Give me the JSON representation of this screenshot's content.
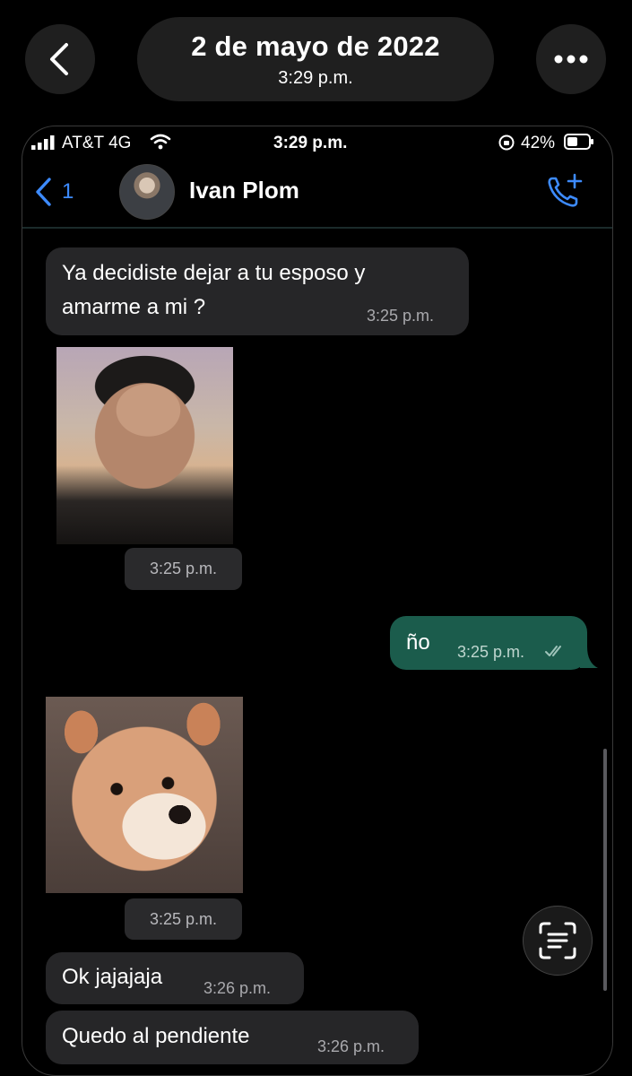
{
  "viewer": {
    "date": "2 de mayo de 2022",
    "time": "3:29 p.m."
  },
  "status_bar": {
    "carrier": "AT&T 4G",
    "time": "3:29 p.m.",
    "battery": "42%"
  },
  "chat_header": {
    "back_count": "1",
    "contact_name": "Ivan Plom"
  },
  "messages": [
    {
      "type": "text",
      "direction": "in",
      "text": "Ya decidiste dejar a tu esposo y",
      "text2": "amarme a mi ?",
      "time": "3:25 p.m."
    },
    {
      "type": "image",
      "direction": "in",
      "time": "3:25 p.m."
    },
    {
      "type": "text",
      "direction": "out",
      "text": "ño",
      "time": "3:25 p.m."
    },
    {
      "type": "image",
      "direction": "in",
      "time": "3:25 p.m."
    },
    {
      "type": "text",
      "direction": "in",
      "text": "Ok jajajaja",
      "time": "3:26 p.m."
    },
    {
      "type": "text",
      "direction": "in",
      "text": "Quedo al pendiente",
      "time": "3:26 p.m."
    }
  ],
  "colors": {
    "incoming_bubble": "#262628",
    "outgoing_bubble": "#1b5c4c",
    "accent_blue": "#3d8bff"
  },
  "icons": [
    "back-chevron-icon",
    "more-dots-icon",
    "signal-icon",
    "wifi-icon",
    "rotation-lock-icon",
    "battery-icon",
    "back-arrow-icon",
    "add-call-icon",
    "read-check-icon",
    "text-scan-icon"
  ]
}
